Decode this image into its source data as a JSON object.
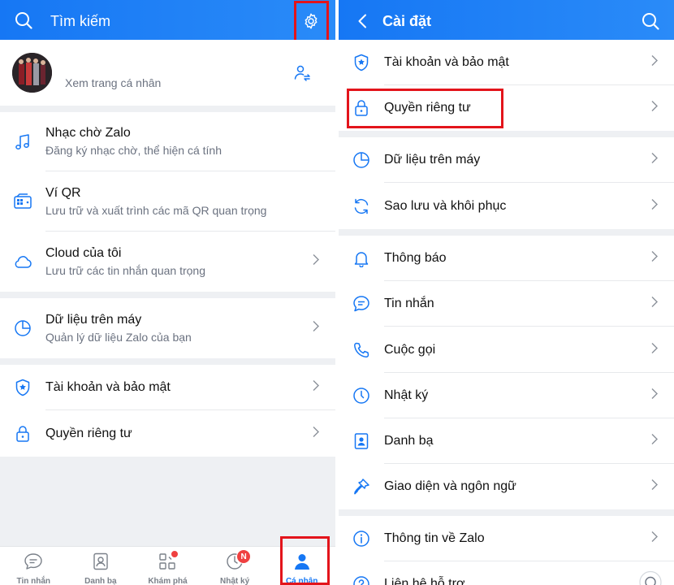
{
  "colors": {
    "brand": "#1677f4",
    "highlight": "#e3141b",
    "icon": "#1677f4",
    "badge": "#ef4040"
  },
  "left": {
    "search_placeholder": "Tìm kiếm",
    "profile": {
      "link_text": "Xem trang cá nhân"
    },
    "items": [
      {
        "title": "Nhạc chờ Zalo",
        "subtitle": "Đăng ký nhạc chờ, thể hiện cá tính",
        "icon": "music-note-icon"
      },
      {
        "title": "Ví QR",
        "subtitle": "Lưu trữ và xuất trình các mã QR quan trọng",
        "icon": "qr-wallet-icon"
      },
      {
        "title": "Cloud của tôi",
        "subtitle": "Lưu trữ các tin nhắn quan trọng",
        "icon": "cloud-icon"
      },
      {
        "title": "Dữ liệu trên máy",
        "subtitle": "Quản lý dữ liệu Zalo của bạn",
        "icon": "pie-chart-icon"
      },
      {
        "title": "Tài khoản và bảo mật",
        "icon": "shield-icon"
      },
      {
        "title": "Quyền riêng tư",
        "icon": "lock-icon"
      }
    ],
    "nav": [
      {
        "label": "Tin nhắn",
        "icon": "chat-icon"
      },
      {
        "label": "Danh bạ",
        "icon": "contacts-icon"
      },
      {
        "label": "Khám phá",
        "icon": "grid-icon"
      },
      {
        "label": "Nhật ký",
        "icon": "clock-icon",
        "badge": "N"
      },
      {
        "label": "Cá nhân",
        "icon": "person-icon",
        "active": true
      }
    ]
  },
  "right": {
    "title": "Cài đặt",
    "items": [
      {
        "label": "Tài khoản và bảo mật",
        "icon": "shield-icon"
      },
      {
        "label": "Quyền riêng tư",
        "icon": "lock-icon"
      },
      {
        "label": "Dữ liệu trên máy",
        "icon": "pie-chart-icon"
      },
      {
        "label": "Sao lưu và khôi phục",
        "icon": "sync-icon"
      },
      {
        "label": "Thông báo",
        "icon": "bell-icon"
      },
      {
        "label": "Tin nhắn",
        "icon": "message-icon"
      },
      {
        "label": "Cuộc gọi",
        "icon": "phone-icon"
      },
      {
        "label": "Nhật ký",
        "icon": "clock-icon"
      },
      {
        "label": "Danh bạ",
        "icon": "contacts-book-icon"
      },
      {
        "label": "Giao diện và ngôn ngữ",
        "icon": "brush-icon"
      },
      {
        "label": "Thông tin về Zalo",
        "icon": "info-icon"
      },
      {
        "label": "Liên hệ hỗ trợ",
        "icon": "support-icon"
      }
    ]
  }
}
